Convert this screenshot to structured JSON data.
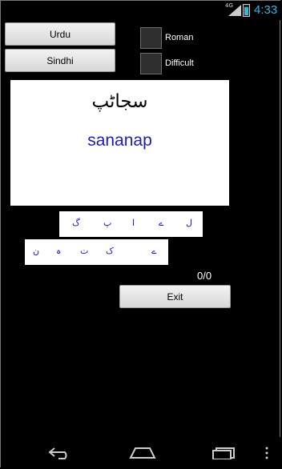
{
  "status_bar": {
    "network_label": "4G",
    "time": "4:33",
    "icons": [
      "signal-icon",
      "battery-icon"
    ]
  },
  "buttons": {
    "urdu": "Urdu",
    "sindhi": "Sindhi",
    "exit": "Exit"
  },
  "checkboxes": {
    "roman": {
      "label": "Roman",
      "checked": false
    },
    "difficult": {
      "label": "Difficult",
      "checked": false
    }
  },
  "card": {
    "urdu_word": "سجاڻپ",
    "roman_word": "sananap"
  },
  "letters_row1": [
    "ل",
    "ے",
    "ا",
    "پ",
    "گ"
  ],
  "letters_row2": [
    "ے",
    "ک",
    "ت",
    "ہ",
    "ن"
  ],
  "score": "0/0",
  "nav": {
    "icons": [
      "back-icon",
      "home-icon",
      "recent-apps-icon",
      "menu-icon"
    ]
  },
  "colors": {
    "accent": "#33b5e5",
    "roman_text": "#1c1cb8",
    "background": "#000000"
  }
}
